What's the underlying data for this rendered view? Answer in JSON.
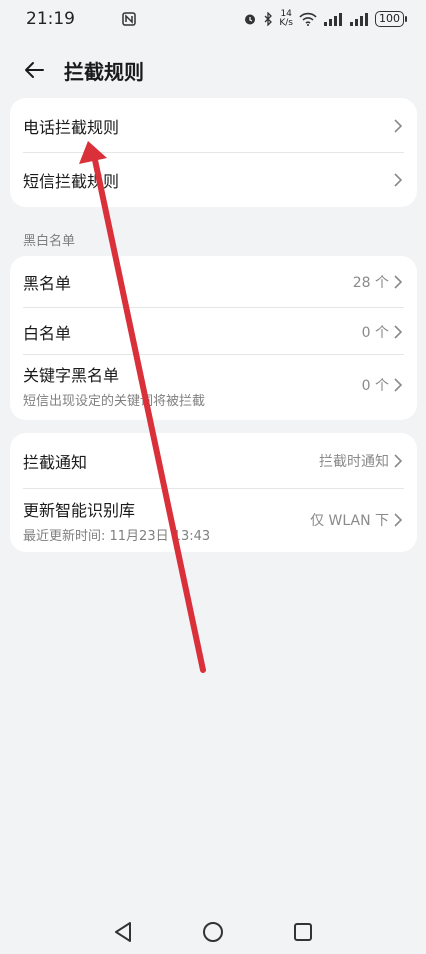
{
  "status_bar": {
    "time": "21:19",
    "speed_value": "14",
    "speed_unit": "K/s",
    "battery": "100"
  },
  "header": {
    "title": "拦截规则"
  },
  "card1": {
    "items": [
      {
        "label": "电话拦截规则"
      },
      {
        "label": "短信拦截规则"
      }
    ]
  },
  "section": {
    "title": "黑白名单"
  },
  "card2": {
    "items": [
      {
        "label": "黑名单",
        "value": "28 个"
      },
      {
        "label": "白名单",
        "value": "0 个"
      },
      {
        "label": "关键字黑名单",
        "sublabel": "短信出现设定的关键词将被拦截",
        "value": "0 个"
      }
    ]
  },
  "card3": {
    "items": [
      {
        "label": "拦截通知",
        "value": "拦截时通知"
      },
      {
        "label": "更新智能识别库",
        "sublabel": "最近更新时间: 11月23日 13:43",
        "value": "仅 WLAN 下"
      }
    ]
  },
  "colors": {
    "background": "#f1f3f5",
    "card": "#ffffff",
    "annotation_arrow": "#d9303a"
  }
}
